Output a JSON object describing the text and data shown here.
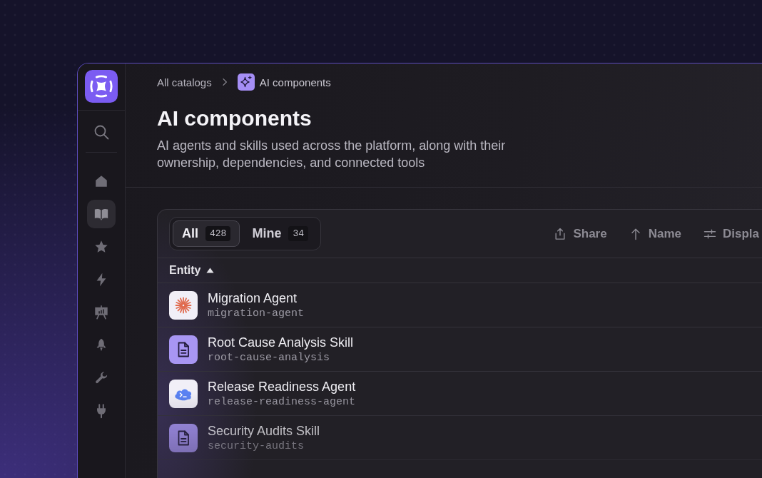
{
  "sidebar": {
    "items": [
      {
        "selected": false
      },
      {
        "selected": true
      },
      {
        "selected": false
      },
      {
        "selected": false
      },
      {
        "selected": false
      },
      {
        "selected": false
      },
      {
        "selected": false
      },
      {
        "selected": false
      }
    ]
  },
  "breadcrumb": [
    {
      "label": "All catalogs"
    },
    {
      "label": "AI components"
    }
  ],
  "page": {
    "title": "AI components",
    "description": "AI agents and skills used across the platform, along with their ownership, dependencies, and connected tools"
  },
  "tabs": [
    {
      "label": "All",
      "count": "428",
      "selected": true
    },
    {
      "label": "Mine",
      "count": "34",
      "selected": false
    }
  ],
  "toolbar": [
    {
      "label": "Share"
    },
    {
      "label": "Name"
    },
    {
      "label": "Displa"
    }
  ],
  "table": {
    "columns": [
      {
        "label": "Entity",
        "sorted": true
      }
    ],
    "rows": [
      {
        "kind": "agent",
        "name": "Migration Agent",
        "slug": "migration-agent"
      },
      {
        "kind": "skill",
        "name": "Root Cause Analysis Skill",
        "slug": "root-cause-analysis"
      },
      {
        "kind": "agent",
        "name": "Release Readiness Agent",
        "slug": "release-readiness-agent"
      },
      {
        "kind": "skill",
        "name": "Security Audits Skill",
        "slug": "security-audits"
      }
    ]
  }
}
